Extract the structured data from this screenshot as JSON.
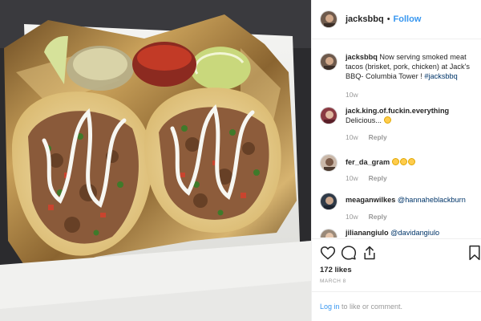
{
  "post": {
    "username": "jacksbbq",
    "follow_label": "Follow",
    "separator": "•"
  },
  "caption": {
    "username": "jacksbbq",
    "text": " Now serving smoked meat tacos (brisket, pork, chicken) at Jack's BBQ- Columbia Tower ! ",
    "hashtag": "#jacksbbq",
    "time": "10w"
  },
  "comments": [
    {
      "username": "jack.king.of.fuckin.everything",
      "text": "Delicious... ",
      "emoji_count": 1,
      "time": "10w",
      "reply": "Reply"
    },
    {
      "username": "fer_da_gram",
      "text": "",
      "emoji_count": 3,
      "time": "10w",
      "reply": "Reply"
    },
    {
      "username": "meaganwilkes",
      "mention": "@hannaheblackburn",
      "time": "10w",
      "reply": "Reply"
    },
    {
      "username": "jilianangiulo",
      "mention": "@davidangiulo"
    }
  ],
  "likes": "172 likes",
  "date": "MARCH 8",
  "login": {
    "link": "Log in",
    "rest": " to like or comment."
  },
  "icons": [
    "heart-icon",
    "comment-icon",
    "share-icon",
    "bookmark-icon"
  ],
  "colors": {
    "link": "#3897f0",
    "hashtag": "#003569",
    "muted": "#999999"
  }
}
